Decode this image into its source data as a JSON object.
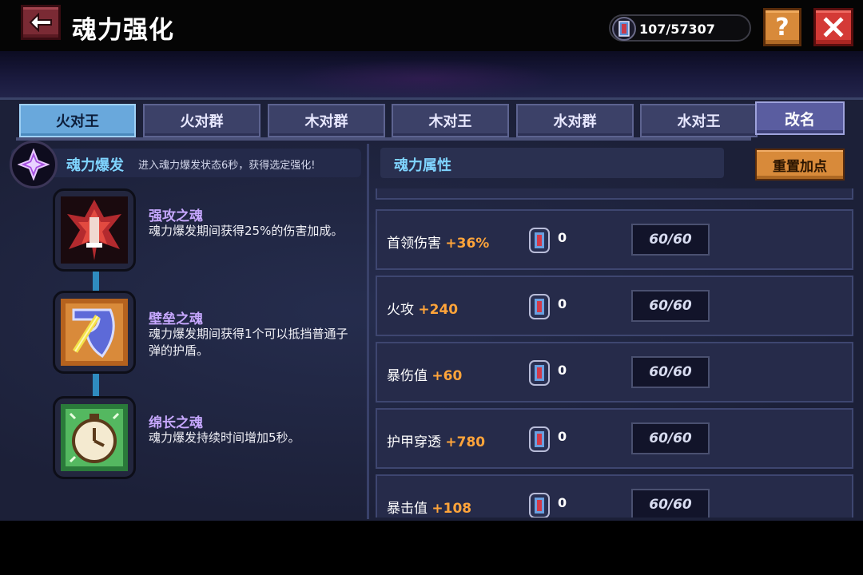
{
  "header": {
    "title": "魂力强化",
    "currency_value": "107/57307",
    "help_label": "?"
  },
  "tabs": [
    {
      "label": "火对王",
      "active": true
    },
    {
      "label": "火对群",
      "active": false
    },
    {
      "label": "木对群",
      "active": false
    },
    {
      "label": "木对王",
      "active": false
    },
    {
      "label": "水对群",
      "active": false
    },
    {
      "label": "水对王",
      "active": false
    }
  ],
  "rename_label": "改名",
  "burst": {
    "title": "魂力爆发",
    "description": "进入魂力爆发状态6秒，获得选定强化!"
  },
  "skills": [
    {
      "name": "强攻之魂",
      "description": "魂力爆发期间获得25%的伤害加成。",
      "icon": "fire-spirit-icon"
    },
    {
      "name": "壁垒之魂",
      "description": "魂力爆发期间获得1个可以抵挡普通子弹的护盾。",
      "icon": "shield-spirit-icon"
    },
    {
      "name": "绵长之魂",
      "description": "魂力爆发持续时间增加5秒。",
      "icon": "clock-spirit-icon"
    }
  ],
  "attributes": {
    "title": "魂力属性",
    "reset_label": "重置加点",
    "rows": [
      {
        "name": "首领伤害",
        "bonus": "+36%",
        "cost": "0",
        "level": "60/60"
      },
      {
        "name": "火攻",
        "bonus": "+240",
        "cost": "0",
        "level": "60/60"
      },
      {
        "name": "暴伤值",
        "bonus": "+60",
        "cost": "0",
        "level": "60/60"
      },
      {
        "name": "护甲穿透",
        "bonus": "+780",
        "cost": "0",
        "level": "60/60"
      },
      {
        "name": "暴击值",
        "bonus": "+108",
        "cost": "0",
        "level": "60/60"
      }
    ]
  },
  "colors": {
    "accent_cyan": "#7fd4ff",
    "bonus_orange": "#ffa43a",
    "tab_active": "#69a8dc",
    "skill_name_purple": "#c7a8ff"
  }
}
